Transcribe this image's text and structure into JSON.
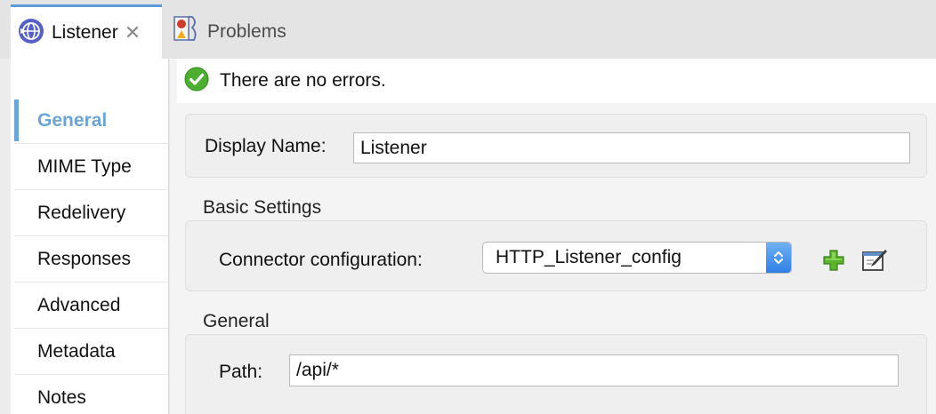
{
  "tabs": [
    {
      "label": "Listener",
      "icon": "listener-globe-icon",
      "active": true,
      "closable": true
    },
    {
      "label": "Problems",
      "icon": "problems-icon",
      "active": false
    }
  ],
  "sidebar": {
    "items": [
      {
        "label": "General",
        "active": true
      },
      {
        "label": "MIME Type"
      },
      {
        "label": "Redelivery"
      },
      {
        "label": "Responses"
      },
      {
        "label": "Advanced"
      },
      {
        "label": "Metadata"
      },
      {
        "label": "Notes"
      }
    ]
  },
  "status": {
    "message": "There are no errors.",
    "icon": "check-circle-icon"
  },
  "display_name": {
    "label": "Display Name:",
    "value": "Listener"
  },
  "basic_settings": {
    "title": "Basic Settings",
    "connector_label": "Connector configuration:",
    "connector_value": "HTTP_Listener_config",
    "add_icon": "plus-icon",
    "edit_icon": "edit-icon"
  },
  "general": {
    "title": "General",
    "path_label": "Path:",
    "path_value": "/api/*"
  },
  "colors": {
    "accent": "#6aa4d8",
    "tab_indicator": "#5c9ad6",
    "success": "#4caf2f",
    "add": "#5bb52c",
    "select_stepper": "#2f7fe6"
  }
}
